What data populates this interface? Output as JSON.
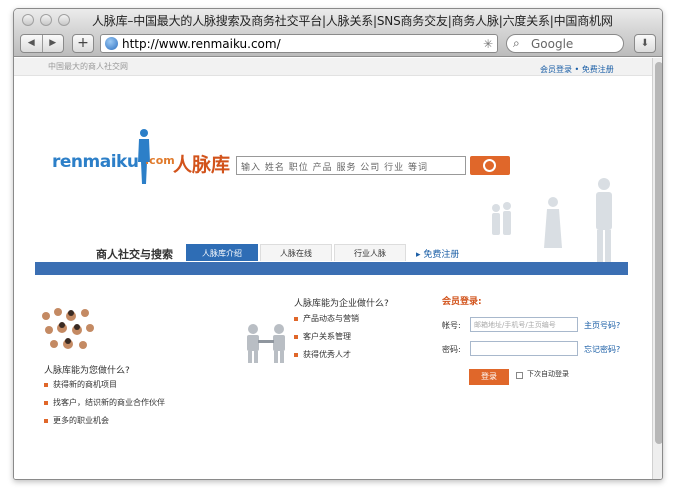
{
  "window": {
    "title": "人脉库–中国最大的人脉搜索及商务社交平台|人脉关系|SNS商务交友|商务人脉|六度关系|中国商机网"
  },
  "toolbar": {
    "back": "◀",
    "forward": "▶",
    "add": "+",
    "url": "http://www.renmaiku.com/",
    "search_placeholder": "Google"
  },
  "topbar": {
    "tagline": "中国最大的商人社交网",
    "login": "会员登录",
    "separator": "•",
    "register": "免费注册"
  },
  "brand": {
    "logo": "renmaiku",
    "dotcom": ".com",
    "name_cn": "人脉库"
  },
  "search": {
    "placeholder": "输入 姓名 职位 产品 服务 公司 行业 等词"
  },
  "nav": {
    "title": "商人社交与搜索",
    "tabs": [
      {
        "label": "人脉库介绍",
        "active": true
      },
      {
        "label": "人脉在线",
        "active": false
      },
      {
        "label": "行业人脉",
        "active": false
      }
    ],
    "free_register": "▸ 免费注册"
  },
  "section_person": {
    "heading": "人脉库能为您做什么?",
    "items": [
      "获得新的商机项目",
      "找客户，结识新的商业合作伙伴",
      "更多的职业机会"
    ]
  },
  "section_company": {
    "heading": "人脉库能为企业做什么?",
    "items": [
      "产品动态与营销",
      "客户关系管理",
      "获得优秀人才"
    ]
  },
  "login": {
    "title": "会员登录:",
    "account_label": "帐号:",
    "account_placeholder": "邮箱地址/手机号/主页编号",
    "account_link": "主页号码?",
    "password_label": "密码:",
    "password_link": "忘记密码?",
    "button": "登录",
    "auto_login": "下次自动登录"
  },
  "colors": {
    "brand_orange": "#e0672a",
    "brand_blue": "#2c7fc8",
    "nav_blue": "#3b6fb3",
    "link_blue": "#1a5ea6"
  }
}
